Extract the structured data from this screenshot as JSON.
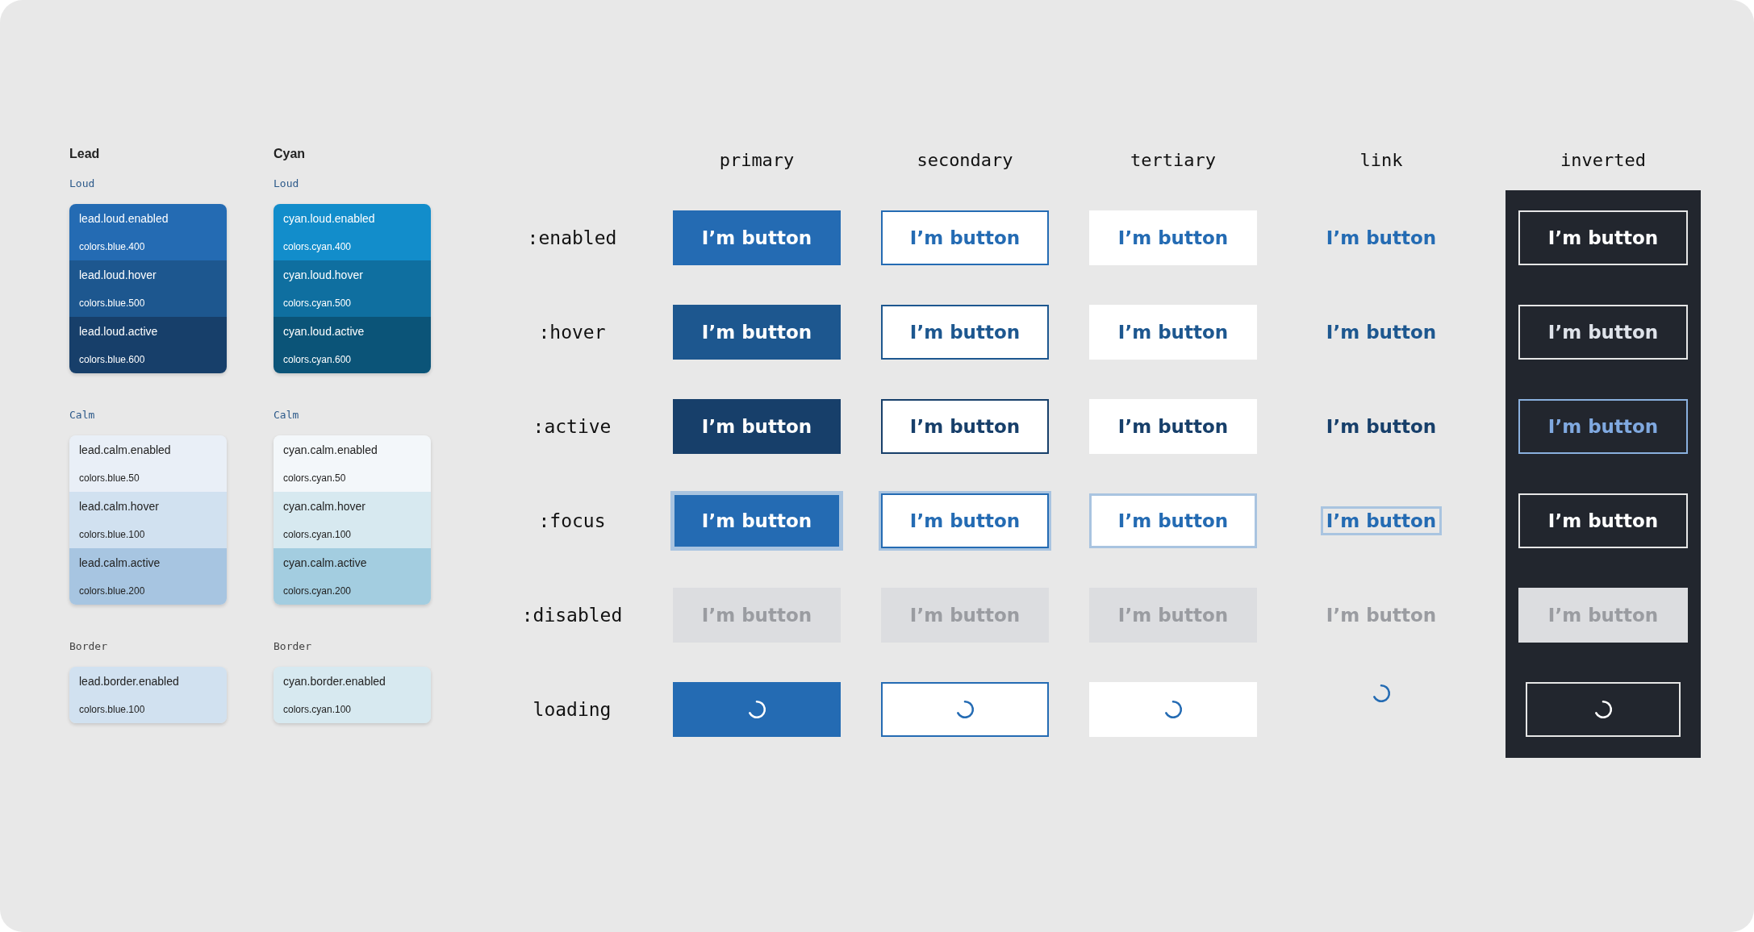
{
  "palettes": [
    {
      "title": "Lead",
      "sections": [
        {
          "title": "Loud",
          "kind": "loud",
          "swatches": [
            {
              "token": "lead.loud.enabled",
              "value": "colors.blue.400",
              "color": "#246bb3"
            },
            {
              "token": "lead.loud.hover",
              "value": "colors.blue.500",
              "color": "#1d578f"
            },
            {
              "token": "lead.loud.active",
              "value": "colors.blue.600",
              "color": "#173f6a"
            }
          ]
        },
        {
          "title": "Calm",
          "kind": "calm",
          "swatches": [
            {
              "token": "lead.calm.enabled",
              "value": "colors.blue.50",
              "color": "#e9eff7"
            },
            {
              "token": "lead.calm.hover",
              "value": "colors.blue.100",
              "color": "#d1e1f0"
            },
            {
              "token": "lead.calm.active",
              "value": "colors.blue.200",
              "color": "#a7c5e1"
            }
          ]
        },
        {
          "title": "Border",
          "kind": "border",
          "swatches": [
            {
              "token": "lead.border.enabled",
              "value": "colors.blue.100",
              "color": "#d1e1f0"
            }
          ]
        }
      ]
    },
    {
      "title": "Cyan",
      "sections": [
        {
          "title": "Loud",
          "kind": "loud",
          "swatches": [
            {
              "token": "cyan.loud.enabled",
              "value": "colors.cyan.400",
              "color": "#128dcb"
            },
            {
              "token": "cyan.loud.hover",
              "value": "colors.cyan.500",
              "color": "#0f6fa0"
            },
            {
              "token": "cyan.loud.active",
              "value": "colors.cyan.600",
              "color": "#0b5478"
            }
          ]
        },
        {
          "title": "Calm",
          "kind": "calm",
          "swatches": [
            {
              "token": "cyan.calm.enabled",
              "value": "colors.cyan.50",
              "color": "#f3f7fa"
            },
            {
              "token": "cyan.calm.hover",
              "value": "colors.cyan.100",
              "color": "#d7e9f0"
            },
            {
              "token": "cyan.calm.active",
              "value": "colors.cyan.200",
              "color": "#a3cde0"
            }
          ]
        },
        {
          "title": "Border",
          "kind": "border",
          "swatches": [
            {
              "token": "cyan.border.enabled",
              "value": "colors.cyan.100",
              "color": "#d7e9f0"
            }
          ]
        }
      ]
    }
  ],
  "variants": [
    {
      "label": "primary",
      "kind": "primary"
    },
    {
      "label": "secondary",
      "kind": "secondary"
    },
    {
      "label": "tertiary",
      "kind": "tertiary"
    },
    {
      "label": "link",
      "kind": "link"
    },
    {
      "label": "inverted",
      "kind": "inverted"
    }
  ],
  "rows": [
    {
      "label": ":enabled",
      "kind": "enabled",
      "buttons": [
        "I’m button",
        "I’m button",
        "I’m button",
        "I’m button",
        "I’m button"
      ]
    },
    {
      "label": ":hover",
      "kind": "hover",
      "buttons": [
        "I’m button",
        "I’m button",
        "I’m button",
        "I’m button",
        "I’m button"
      ]
    },
    {
      "label": ":active",
      "kind": "active",
      "buttons": [
        "I’m button",
        "I’m button",
        "I’m button",
        "I’m button",
        "I’m button"
      ]
    },
    {
      "label": ":focus",
      "kind": "focus",
      "buttons": [
        "I’m button",
        "I’m button",
        "I’m button",
        "I’m button",
        "I’m button"
      ]
    },
    {
      "label": ":disabled",
      "kind": "disabled",
      "buttons": [
        "I’m button",
        "I’m button",
        "I’m button",
        "I’m button",
        "I’m button"
      ]
    },
    {
      "label": "loading",
      "kind": "loading"
    }
  ]
}
